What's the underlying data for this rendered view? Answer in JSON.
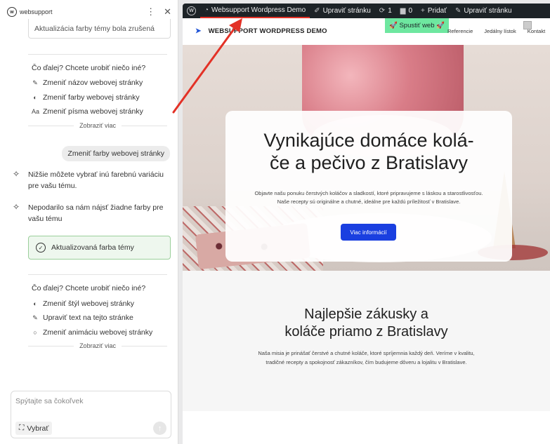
{
  "panel": {
    "brand": "websupport",
    "status_top": "Aktualizácia farby témy bola zrušená",
    "next1": {
      "title": "Čo ďalej? Chcete urobiť niečo iné?",
      "options": [
        {
          "icon": "pen-icon",
          "glyph": "✎",
          "label": "Zmeniť názov webovej stránky"
        },
        {
          "icon": "contrast-icon",
          "glyph": "◐",
          "label": "Zmeniť farby webovej stránky"
        },
        {
          "icon": "font-icon",
          "glyph": "Aa",
          "label": "Zmeniť písma webovej stránky"
        }
      ],
      "more": "Zobraziť viac"
    },
    "user_message": "Zmeniť farby webovej stránky",
    "ai_messages": [
      "Nižšie môžete vybrať inú farebnú variáciu pre vašu tému.",
      "Nepodarilo sa nám nájsť žiadne farby pre vašu tému"
    ],
    "status_ok": "Aktualizovaná farba témy",
    "next2": {
      "title": "Čo ďalej? Chcete urobiť niečo iné?",
      "options": [
        {
          "icon": "contrast-icon",
          "glyph": "◐",
          "label": "Zmeniť štýl webovej stránky"
        },
        {
          "icon": "pen-icon",
          "glyph": "✎",
          "label": "Upraviť text na tejto stránke"
        },
        {
          "icon": "circle-icon",
          "glyph": "○",
          "label": "Zmeniť animáciu webovej stránky"
        }
      ],
      "more": "Zobraziť viac"
    },
    "composer": {
      "placeholder": "Spýtajte sa čokoľvek",
      "select_label": "Vybrať"
    }
  },
  "admin_bar": {
    "site_name": "Websupport Wordpress Demo",
    "customize": "Upraviť stránku",
    "updates": "1",
    "comments": "0",
    "new": "Pridať",
    "edit": "Upraviť stránku"
  },
  "site": {
    "brand": "WEBSUPPORT WORDPRESS DEMO",
    "launch": "🚀 Spustiť web 🚀",
    "nav": [
      "Referencie",
      "Jedálny lístok",
      "Kontakt"
    ],
    "hero_title": "Vynikajúce domáce kolá-če a pečivo z Bratislavy",
    "hero_title_lines": [
      "Vynikajúce domáce kolá-",
      "če a pečivo z Bratislavy"
    ],
    "hero_text": "Objavte našu ponuku čerstvých koláčov a sladkostí, ktoré pripravujeme s láskou a starostlivosťou. Naše recepty sú originálne a chutné, ideálne pre každú príležitosť v Bratislave.",
    "hero_button": "Viac informácií",
    "section_title_lines": [
      "Najlepšie zákusky a",
      "koláče priamo z Bratislavy"
    ],
    "section_text": "Naša misia je prinášať čerstvé a chutné koláče, ktoré spríjemnia každý deň. Veríme v kvalitu, tradičné recepty a spokojnosť zákazníkov, čím budujeme dôveru a lojalitu v Bratislave."
  },
  "colors": {
    "admin_bar": "#1d2327",
    "accent_blue": "#1a3fe0",
    "launch_green": "#6ee7a0",
    "arrow_red": "#e33126",
    "success_bg": "#eef7ee"
  }
}
